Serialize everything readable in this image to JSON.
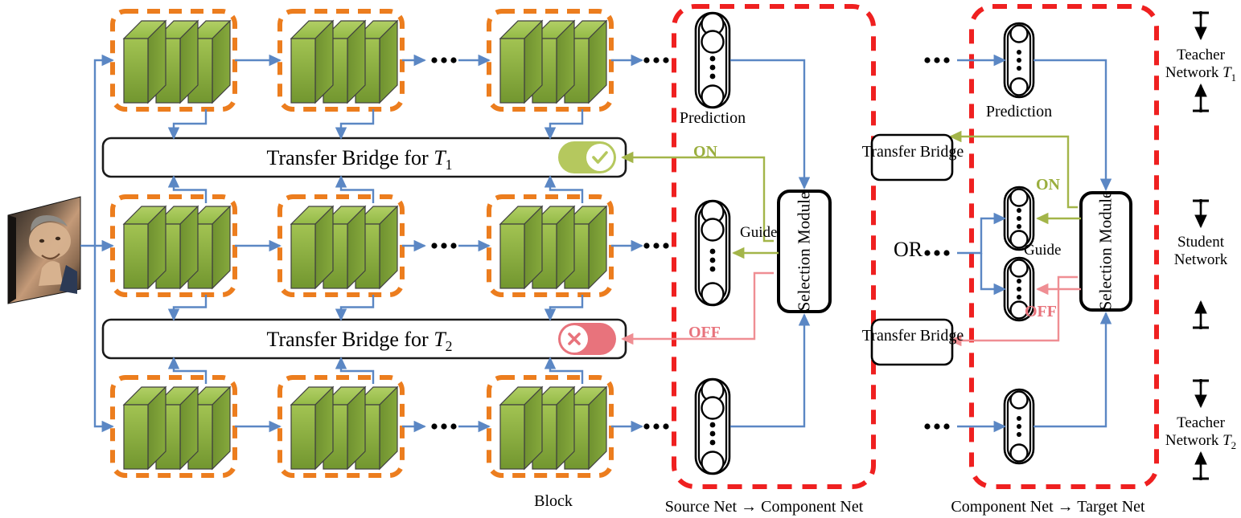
{
  "diagram": {
    "title_caption_left": "Source Net → Component Net",
    "title_caption_right": "Component Net → Target Net",
    "block_caption": "Block",
    "or_label": "OR",
    "colors": {
      "block_green_light": "#8fb33f",
      "block_green_dark": "#6f9130",
      "block_top": "#a8c75a",
      "dashed_orange": "#ec7d1e",
      "arrow_blue": "#5b87c4",
      "panel_red": "#ef2020",
      "on_green": "#a3b549",
      "off_red": "#ef8e93",
      "toggle_on": "#b5c85e",
      "toggle_off": "#e8737c"
    }
  },
  "input": {
    "name": "input-face-image"
  },
  "bridges": [
    {
      "label": "Transfer Bridge for",
      "sub": "T",
      "subscript": "1",
      "state": "on",
      "state_label": "ON",
      "icon": "check-icon"
    },
    {
      "label": "Transfer Bridge for",
      "sub": "T",
      "subscript": "2",
      "state": "off",
      "state_label": "OFF",
      "icon": "cross-icon"
    }
  ],
  "rows": [
    {
      "id": "teacher1",
      "blocks": 3,
      "ellipsis_after": 2
    },
    {
      "id": "student",
      "blocks": 3,
      "ellipsis_after": 2
    },
    {
      "id": "teacher2",
      "blocks": 3,
      "ellipsis_after": 2
    }
  ],
  "left_panel": {
    "name": "source-net-to-component-net-panel",
    "prediction_label": "Prediction",
    "selection_module_label": "Selection Module",
    "guide_label": "Guide",
    "signals": [
      {
        "label": "ON",
        "color": "#a3b549"
      },
      {
        "label": "OFF",
        "color": "#ef8e93"
      }
    ],
    "neurons": [
      {
        "name": "prediction-neuron-top"
      },
      {
        "name": "component-neuron-middle"
      },
      {
        "name": "prediction-neuron-bottom"
      }
    ]
  },
  "right_panel": {
    "name": "component-net-to-target-net-panel",
    "prediction_label": "Prediction",
    "selection_module_label": "Selection Module",
    "guide_label": "Guide",
    "transfer_bridge_top": "Transfer Bridge",
    "transfer_bridge_bottom": "Transfer Bridge",
    "signals": [
      {
        "label": "ON",
        "color": "#a3b549"
      },
      {
        "label": "OFF",
        "color": "#ef8e93"
      }
    ]
  },
  "side_labels": [
    {
      "line1": "Teacher",
      "line2": "Network",
      "symbol": "T",
      "subscript": "1"
    },
    {
      "line1": "Student",
      "line2": "Network",
      "symbol": "",
      "subscript": ""
    },
    {
      "line1": "Teacher",
      "line2": "Network",
      "symbol": "T",
      "subscript": "2"
    }
  ]
}
